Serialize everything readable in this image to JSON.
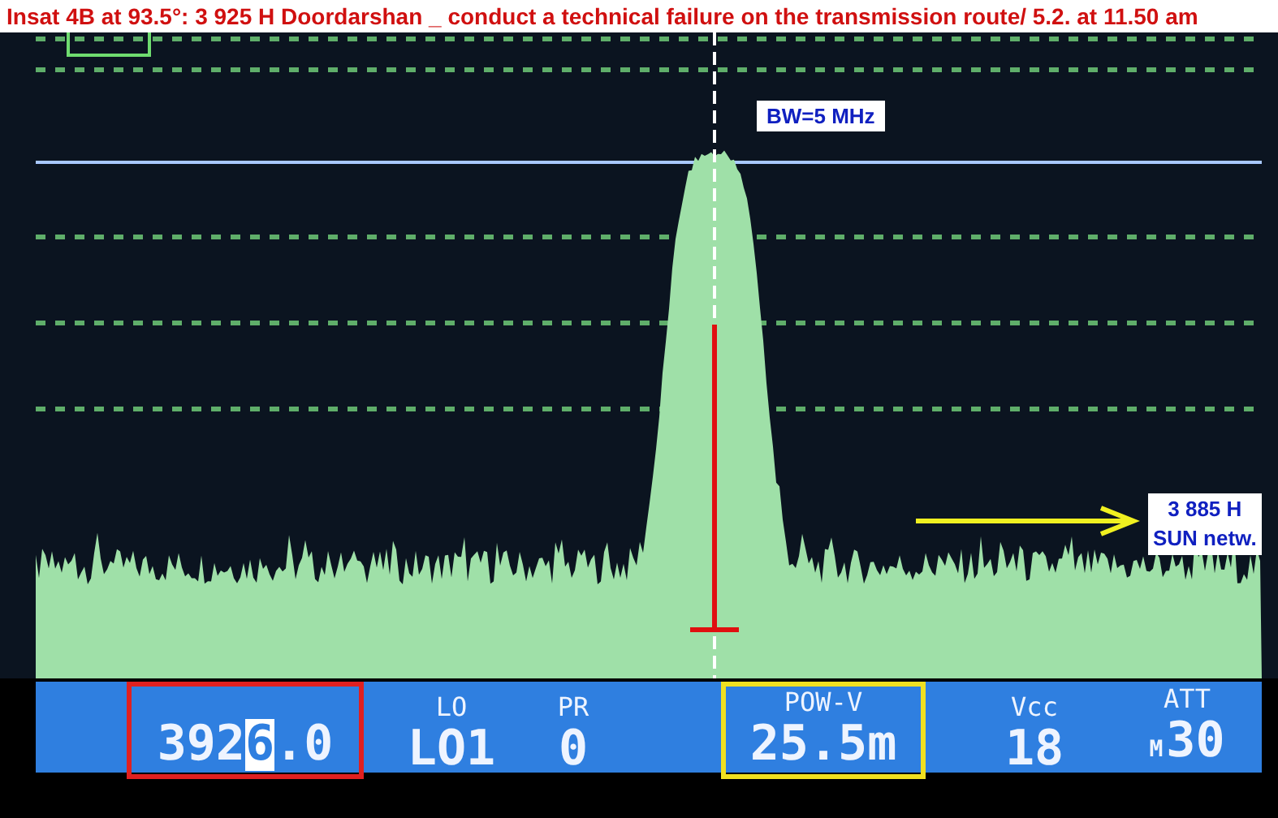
{
  "title": "Insat 4B at 93.5°: 3 925 H Doordarshan _ conduct a technical failure on the transmission route/ 5.2. at 11.50 am",
  "display": {
    "bandwidth_note": "BW=5 MHz",
    "side_note": [
      "3 885 H",
      "SUN netw."
    ]
  },
  "readouts": [
    {
      "kind": "frequency",
      "value_before": "392",
      "cursor": "6",
      "value_after": ".0",
      "color": "#e02020"
    },
    {
      "kind": "plain",
      "label": "LO",
      "value": "LO1"
    },
    {
      "kind": "plain",
      "label": "PR",
      "value": "0"
    },
    {
      "kind": "plain",
      "label": "POW-V",
      "value": "25.5m",
      "color": "#f0e020"
    },
    {
      "kind": "plain",
      "label": "Vcc",
      "value": "18"
    },
    {
      "kind": "prefixed",
      "label": "ATT",
      "prefix": "M",
      "value": "30"
    }
  ]
}
